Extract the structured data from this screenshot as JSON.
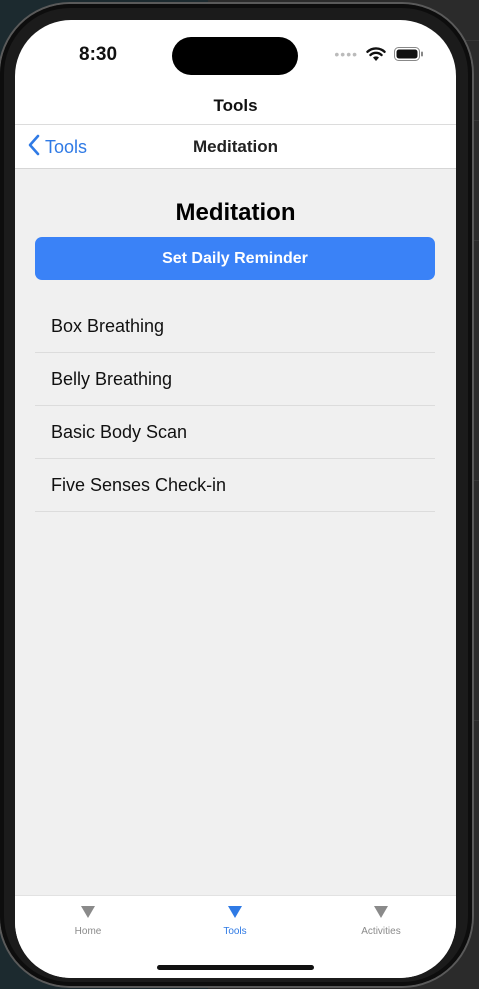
{
  "status_bar": {
    "time": "8:30",
    "signal": "••••"
  },
  "header": {
    "title": "Tools"
  },
  "nav_bar": {
    "back_label": "Tools",
    "title": "Meditation"
  },
  "main": {
    "heading": "Meditation",
    "reminder_button_label": "Set Daily Reminder",
    "items": [
      {
        "label": "Box Breathing"
      },
      {
        "label": "Belly Breathing"
      },
      {
        "label": "Basic Body Scan"
      },
      {
        "label": "Five Senses Check-in"
      }
    ]
  },
  "tab_bar": {
    "tabs": [
      {
        "label": "Home",
        "icon": "triangle-down-icon"
      },
      {
        "label": "Tools",
        "icon": "triangle-down-icon",
        "active": true
      },
      {
        "label": "Activities",
        "icon": "triangle-down-icon"
      }
    ]
  },
  "colors": {
    "accent": "#3a82f7",
    "link": "#2f7ae5",
    "content_bg": "#f0f0f0"
  }
}
